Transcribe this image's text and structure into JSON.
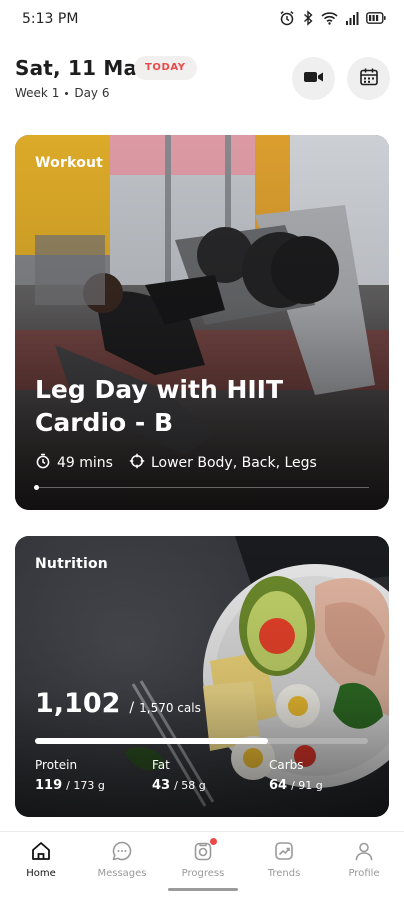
{
  "status_bar": {
    "time": "5:13 PM",
    "icons": [
      "alarm-icon",
      "bluetooth-icon",
      "wifi-icon",
      "signal-icon",
      "battery-icon"
    ]
  },
  "header": {
    "date": "Sat, 11 Mar",
    "badge": "TODAY",
    "week": "Week 1",
    "day": "Day 6"
  },
  "workout": {
    "label": "Workout",
    "title": "Leg Day with HIIT Cardio - B",
    "duration": "49 mins",
    "target": "Lower Body, Back, Legs"
  },
  "nutrition": {
    "label": "Nutrition",
    "calories_current": "1,102",
    "calories_goal": "1,570 cals",
    "calories_progress": 0.7,
    "protein": {
      "label": "Protein",
      "current": "119",
      "goal": "/ 173 g"
    },
    "fat": {
      "label": "Fat",
      "current": "43",
      "goal": "/ 58 g"
    },
    "carbs": {
      "label": "Carbs",
      "current": "64",
      "goal": "/ 91 g"
    }
  },
  "nav": {
    "home": "Home",
    "messages": "Messages",
    "progress": "Progress",
    "trends": "Trends",
    "profile": "Profile"
  },
  "colors": {
    "accent": "#e84a4a",
    "text": "#1e1e1e",
    "muted": "#9a9a9a"
  }
}
